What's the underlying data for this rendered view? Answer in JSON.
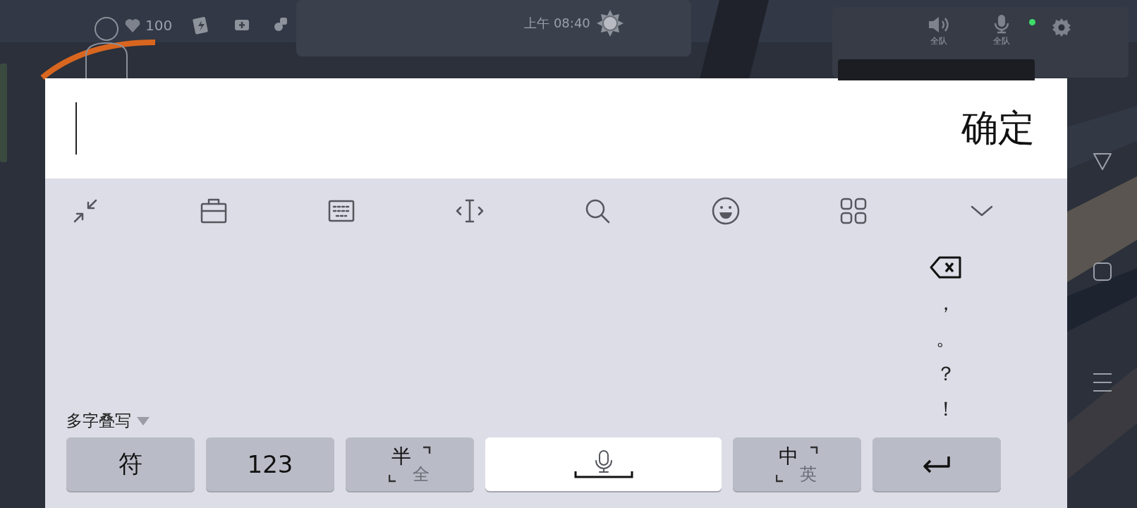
{
  "hud": {
    "health": "100",
    "time": "上午 08:40",
    "speaker_label": "全队",
    "mic_label": "全队"
  },
  "input": {
    "confirm": "确定"
  },
  "side_symbols": [
    "，",
    "。",
    "？",
    "！"
  ],
  "mode_selector": "多字叠写",
  "keys": [
    {
      "kind": "text",
      "label": "符"
    },
    {
      "kind": "text",
      "label": "123"
    },
    {
      "kind": "toggle",
      "primary": "半",
      "secondary": "全"
    },
    {
      "kind": "space"
    },
    {
      "kind": "toggle",
      "primary": "中",
      "secondary": "英"
    },
    {
      "kind": "enter"
    }
  ]
}
